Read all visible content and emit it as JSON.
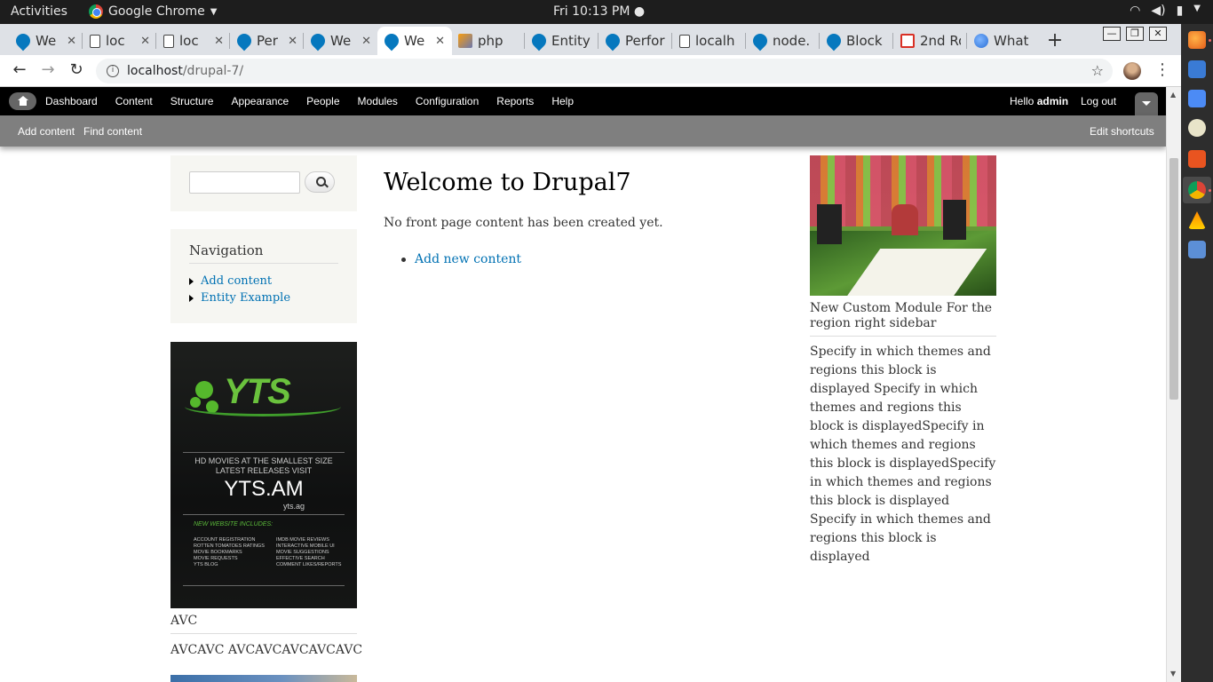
{
  "os": {
    "activities": "Activities",
    "app_name": "Google Chrome",
    "clock": "Fri 10:13 PM ●",
    "tray_icons": [
      "wifi-icon",
      "volume-icon",
      "battery-icon",
      "power-menu-icon"
    ]
  },
  "browser": {
    "tabs": [
      {
        "label": "We",
        "icon": "drupal-icon",
        "active": false
      },
      {
        "label": "loc",
        "icon": "document-icon",
        "active": false
      },
      {
        "label": "loc",
        "icon": "document-icon",
        "active": false
      },
      {
        "label": "Per",
        "icon": "drupal-icon",
        "active": false
      },
      {
        "label": "We",
        "icon": "drupal-icon",
        "active": false
      },
      {
        "label": "We",
        "icon": "drupal-icon",
        "active": true
      },
      {
        "label": "php",
        "icon": "phpmyadmin-icon",
        "active": false
      },
      {
        "label": "Entity",
        "icon": "drupal-icon",
        "active": false
      },
      {
        "label": "Perfor",
        "icon": "drupal-icon",
        "active": false
      },
      {
        "label": "localh",
        "icon": "document-icon",
        "active": false
      },
      {
        "label": "node.",
        "icon": "drupal-icon",
        "active": false
      },
      {
        "label": "Block",
        "icon": "drupal-icon",
        "active": false
      },
      {
        "label": "2nd Ro",
        "icon": "gmail-icon",
        "active": false
      },
      {
        "label": "What",
        "icon": "globe-icon",
        "active": false
      }
    ],
    "new_tab": "+",
    "url_host": "localhost",
    "url_path": "/drupal-7/"
  },
  "admin_toolbar": {
    "menu": [
      "Dashboard",
      "Content",
      "Structure",
      "Appearance",
      "People",
      "Modules",
      "Configuration",
      "Reports",
      "Help"
    ],
    "hello": "Hello ",
    "username": "admin",
    "logout": "Log out",
    "shortcuts": [
      "Add content",
      "Find content"
    ],
    "edit_shortcuts": "Edit shortcuts"
  },
  "sidebar_first": {
    "search_placeholder": "",
    "navigation": {
      "title": "Navigation",
      "items": [
        "Add content",
        "Entity Example"
      ]
    },
    "ad": {
      "logo": "YTS",
      "line1": "HD MOVIES AT THE SMALLEST SIZE",
      "line2": "LATEST RELEASES VISIT",
      "domain": "YTS.AM",
      "alt_domain": "yts.ag",
      "subheading": "NEW WEBSITE INCLUDES:",
      "features_left": [
        "ACCOUNT REGISTRATION",
        "ROTTEN TOMATOES RATINGS",
        "MOVIE BOOKMARKS",
        "MOVIE REQUESTS",
        "YTS BLOG"
      ],
      "features_right": [
        "IMDB MOVIE REVIEWS",
        "INTERACTIVE MOBILE UI",
        "MOVIE SUGGESTIONS",
        "EFFECTIVE SEARCH",
        "COMMENT LIKES/REPORTS"
      ]
    },
    "avc_block": {
      "title": "AVC",
      "body": "AVCAVC AVCAVCAVCAVCAVC"
    }
  },
  "main": {
    "title": "Welcome to Drupal7",
    "message": "No front page content has been created yet.",
    "link": "Add new content"
  },
  "sidebar_second": {
    "block_title": "New Custom Module For the region right sidebar",
    "block_body": "Specify in which themes and regions this block is displayed Specify in which themes and regions this block is displayedSpecify in which themes and regions this block is displayedSpecify in which themes and regions this block is displayed Specify in which themes and regions this block is displayed"
  },
  "colors": {
    "link": "#0071b3",
    "admin_bar": "#000000",
    "shortcut_bar": "#7f7f7f",
    "sidebar_block_bg": "#f6f6f2"
  }
}
